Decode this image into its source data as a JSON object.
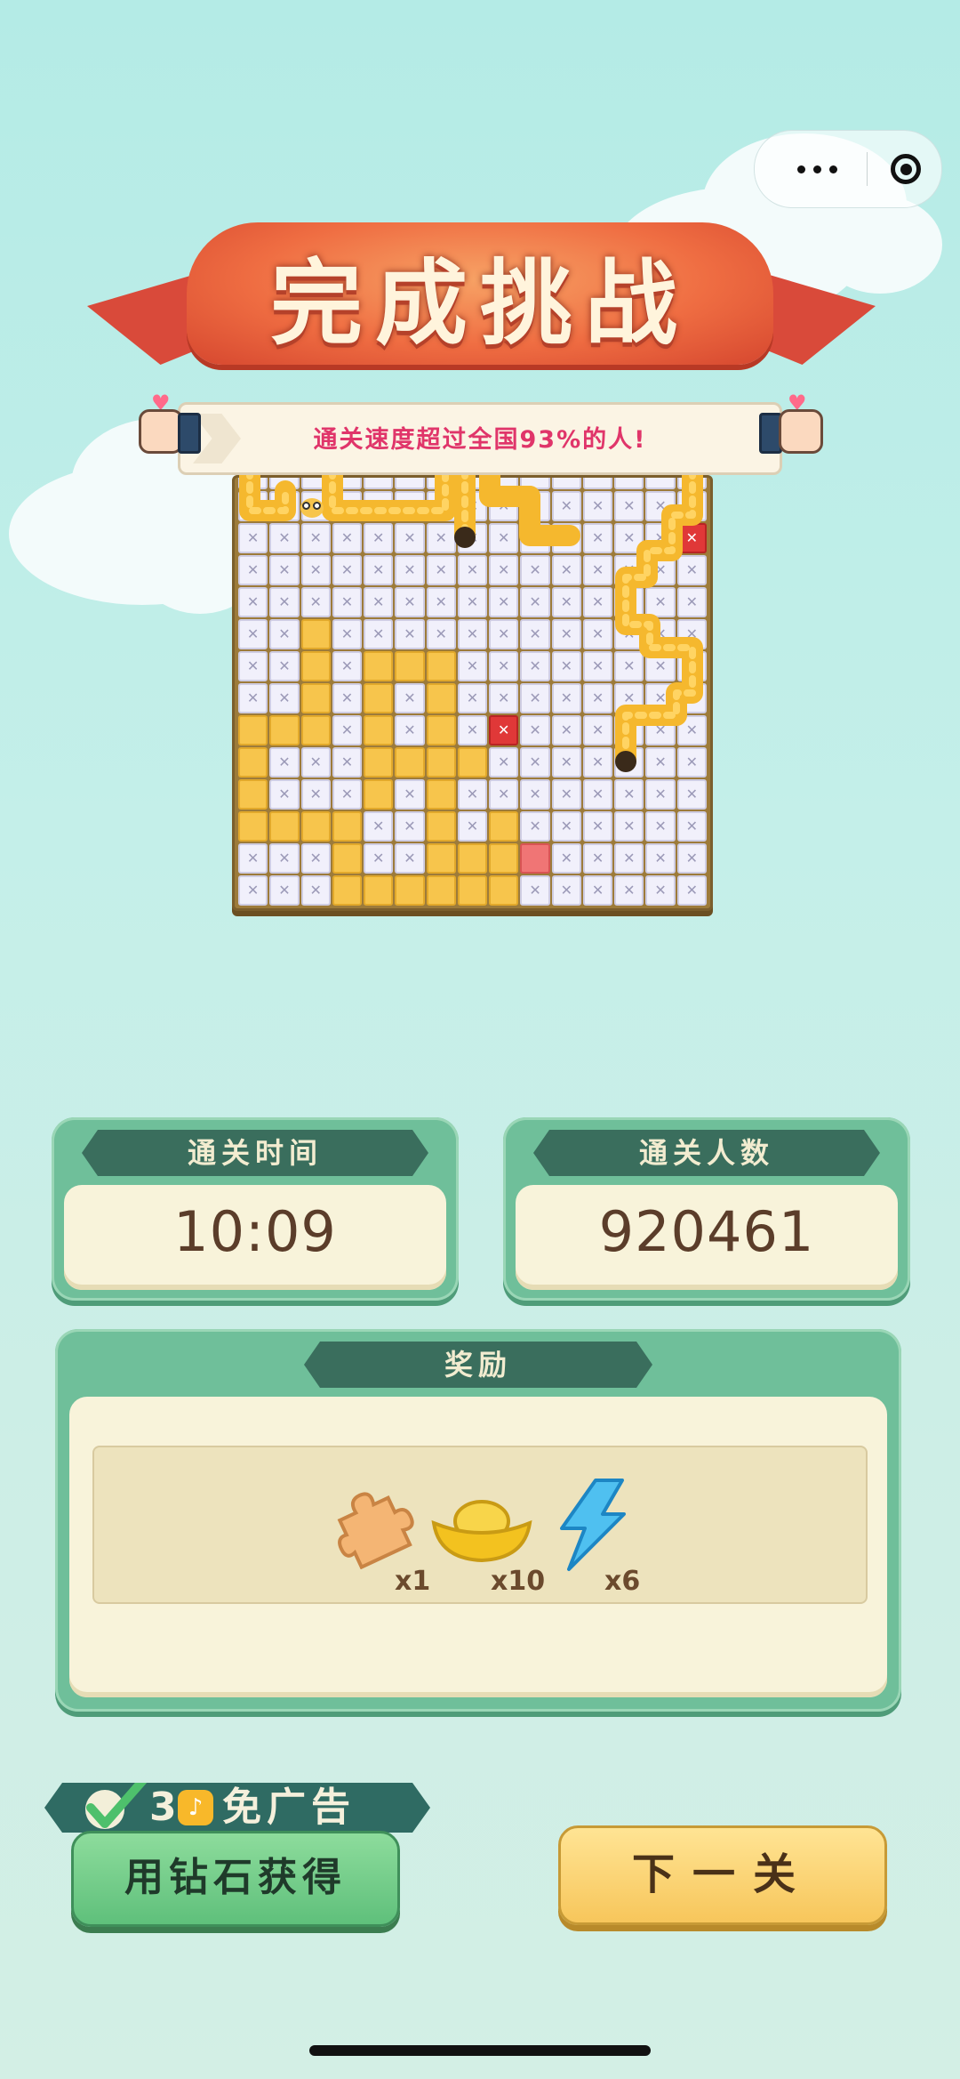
{
  "menu": {
    "more_icon": "more-dots-icon",
    "close_icon": "target-icon"
  },
  "banner": {
    "title": "完成挑战",
    "subtitle": "通关速度超过全国93%的人!"
  },
  "stats": {
    "time_label": "通关时间",
    "time_value": "10:09",
    "players_label": "通关人数",
    "players_value": "920461"
  },
  "rewards": {
    "label": "奖励",
    "items": [
      {
        "icon": "puzzle-piece-icon",
        "count": "x1"
      },
      {
        "icon": "gold-ingot-icon",
        "count": "x10"
      },
      {
        "icon": "lightning-icon",
        "count": "x6"
      }
    ]
  },
  "actions": {
    "ad_free_count": "3",
    "ad_free_text": "免广告",
    "diamond_button": "用钻石获得",
    "next_button": "下一关"
  },
  "colors": {
    "accent_green": "#6fbf9a",
    "accent_yellow": "#f7c65b",
    "title_red": "#ef6d42",
    "subtitle_pink": "#e0356a"
  }
}
